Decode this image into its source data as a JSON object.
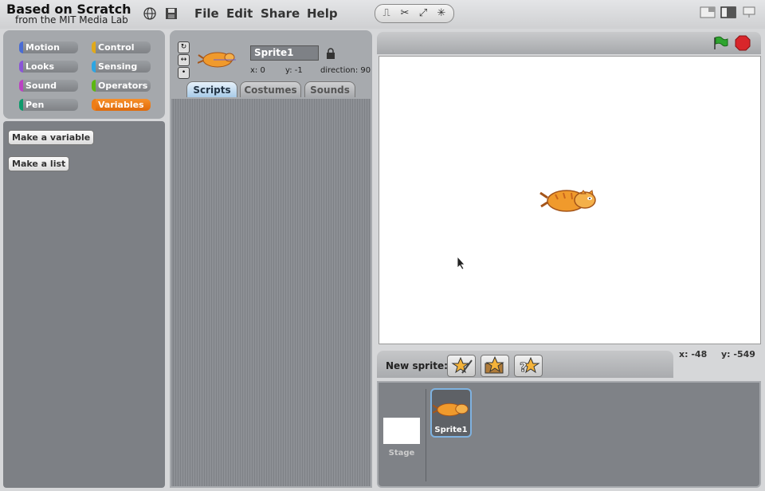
{
  "brand": {
    "title": "Based on Scratch",
    "subtitle": "from the MIT Media Lab"
  },
  "menu": {
    "file": "File",
    "edit": "Edit",
    "share": "Share",
    "help": "Help"
  },
  "categories": [
    {
      "label": "Motion",
      "color": "#4a6cd4"
    },
    {
      "label": "Control",
      "color": "#e1a91a"
    },
    {
      "label": "Looks",
      "color": "#8a55d7"
    },
    {
      "label": "Sensing",
      "color": "#2ca5e2"
    },
    {
      "label": "Sound",
      "color": "#bb42c3"
    },
    {
      "label": "Operators",
      "color": "#5cb712"
    },
    {
      "label": "Pen",
      "color": "#0e9a6c"
    },
    {
      "label": "Variables",
      "color": "#ee7d16"
    }
  ],
  "palette": {
    "make_variable": "Make a variable",
    "make_list": "Make a list"
  },
  "sprite": {
    "name": "Sprite1",
    "x_label": "x:",
    "x": "0",
    "y_label": "y:",
    "y": "-1",
    "direction_label": "direction:",
    "direction": "90"
  },
  "tabs": {
    "scripts": "Scripts",
    "costumes": "Costumes",
    "sounds": "Sounds"
  },
  "stage": {
    "mouse_x_label": "x:",
    "mouse_x": "-48",
    "mouse_y_label": "y:",
    "mouse_y": "-549"
  },
  "new_sprite": {
    "label": "New sprite:"
  },
  "sprite_list": {
    "stage_label": "Stage",
    "sprite1_label": "Sprite1"
  },
  "colors": {
    "accent_selected": "#ee7d16",
    "stage_bg": "#ffffff",
    "green_flag": "#2fa52f",
    "stop": "#d8262b"
  }
}
